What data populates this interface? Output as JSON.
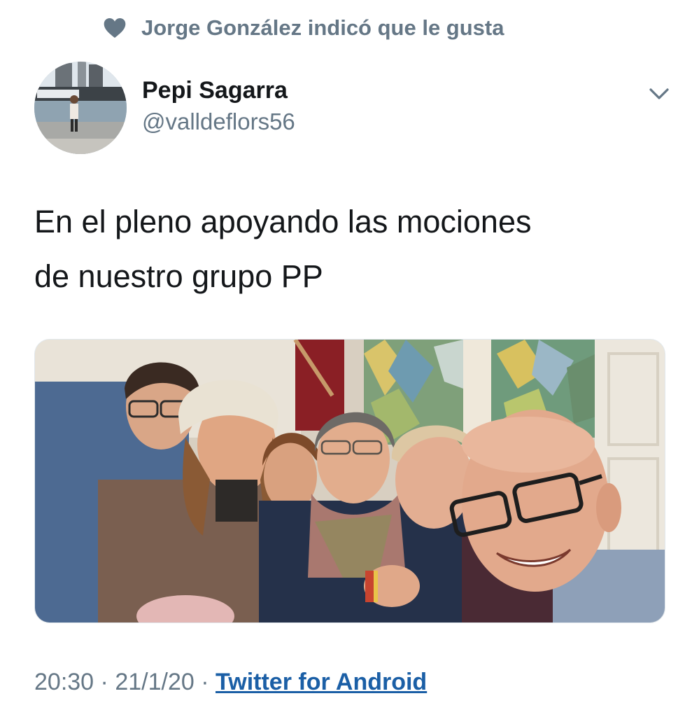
{
  "social_context": {
    "icon": "heart-icon",
    "text": "Jorge González indicó que le gusta"
  },
  "author": {
    "display_name": "Pepi Sagarra",
    "handle": "@valldeflors56",
    "avatar_icon": "avatar-photo"
  },
  "tweet": {
    "text_line_1": "En el pleno apoyando las mociones",
    "text_line_2": "de nuestro grupo PP",
    "media": "group-selfie-photo"
  },
  "meta": {
    "time": "20:30",
    "separator": "·",
    "date": "21/1/20",
    "source": "Twitter for Android"
  },
  "colors": {
    "secondary_text": "#657786",
    "link": "#1b5fa6",
    "primary_text": "#14171a"
  }
}
